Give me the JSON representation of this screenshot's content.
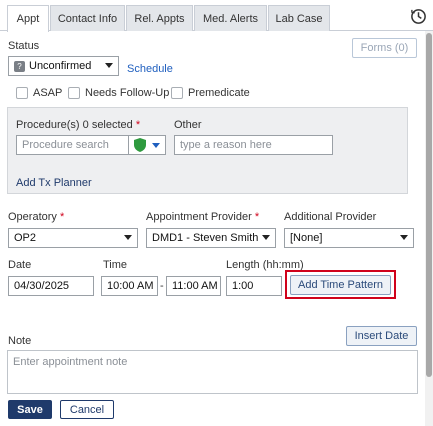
{
  "tabs": [
    {
      "label": "Appt"
    },
    {
      "label": "Contact Info"
    },
    {
      "label": "Rel. Appts"
    },
    {
      "label": "Med. Alerts"
    },
    {
      "label": "Lab Case"
    }
  ],
  "status": {
    "label": "Status",
    "value": "Unconfirmed",
    "schedule_link": "Schedule",
    "forms_button": "Forms (0)"
  },
  "flags": {
    "asap": "ASAP",
    "needs_follow_up": "Needs Follow-Up",
    "premedicate": "Premedicate"
  },
  "procedures": {
    "label": "Procedure(s)",
    "selected_count": "0 selected",
    "required_marker": "*",
    "search_placeholder": "Procedure search",
    "other_label": "Other",
    "other_placeholder": "type a reason here",
    "add_tx_planner": "Add Tx Planner"
  },
  "operatory": {
    "label": "Operatory",
    "required_marker": "*",
    "value": "OP2"
  },
  "provider": {
    "label": "Appointment Provider",
    "required_marker": "*",
    "value": "DMD1 - Steven Smith"
  },
  "additional_provider": {
    "label": "Additional Provider",
    "value": "[None]"
  },
  "date": {
    "label": "Date",
    "value": "04/30/2025"
  },
  "time": {
    "label": "Time",
    "start": "10:00 AM",
    "separator": "-",
    "end": "11:00 AM"
  },
  "length": {
    "label": "Length (hh:mm)",
    "value": "1:00"
  },
  "add_time_pattern": "Add Time Pattern",
  "note": {
    "label": "Note",
    "insert_date": "Insert Date",
    "placeholder": "Enter appointment note"
  },
  "footer": {
    "save": "Save",
    "cancel": "Cancel"
  },
  "colors": {
    "highlight": "#d0021b",
    "shield": "#2e9a3e",
    "primary": "#1f3a6b",
    "link": "#1f5fbf"
  },
  "icons": [
    "clock-history-icon",
    "status-icon",
    "shield-icon",
    "chevron-down-icon"
  ]
}
